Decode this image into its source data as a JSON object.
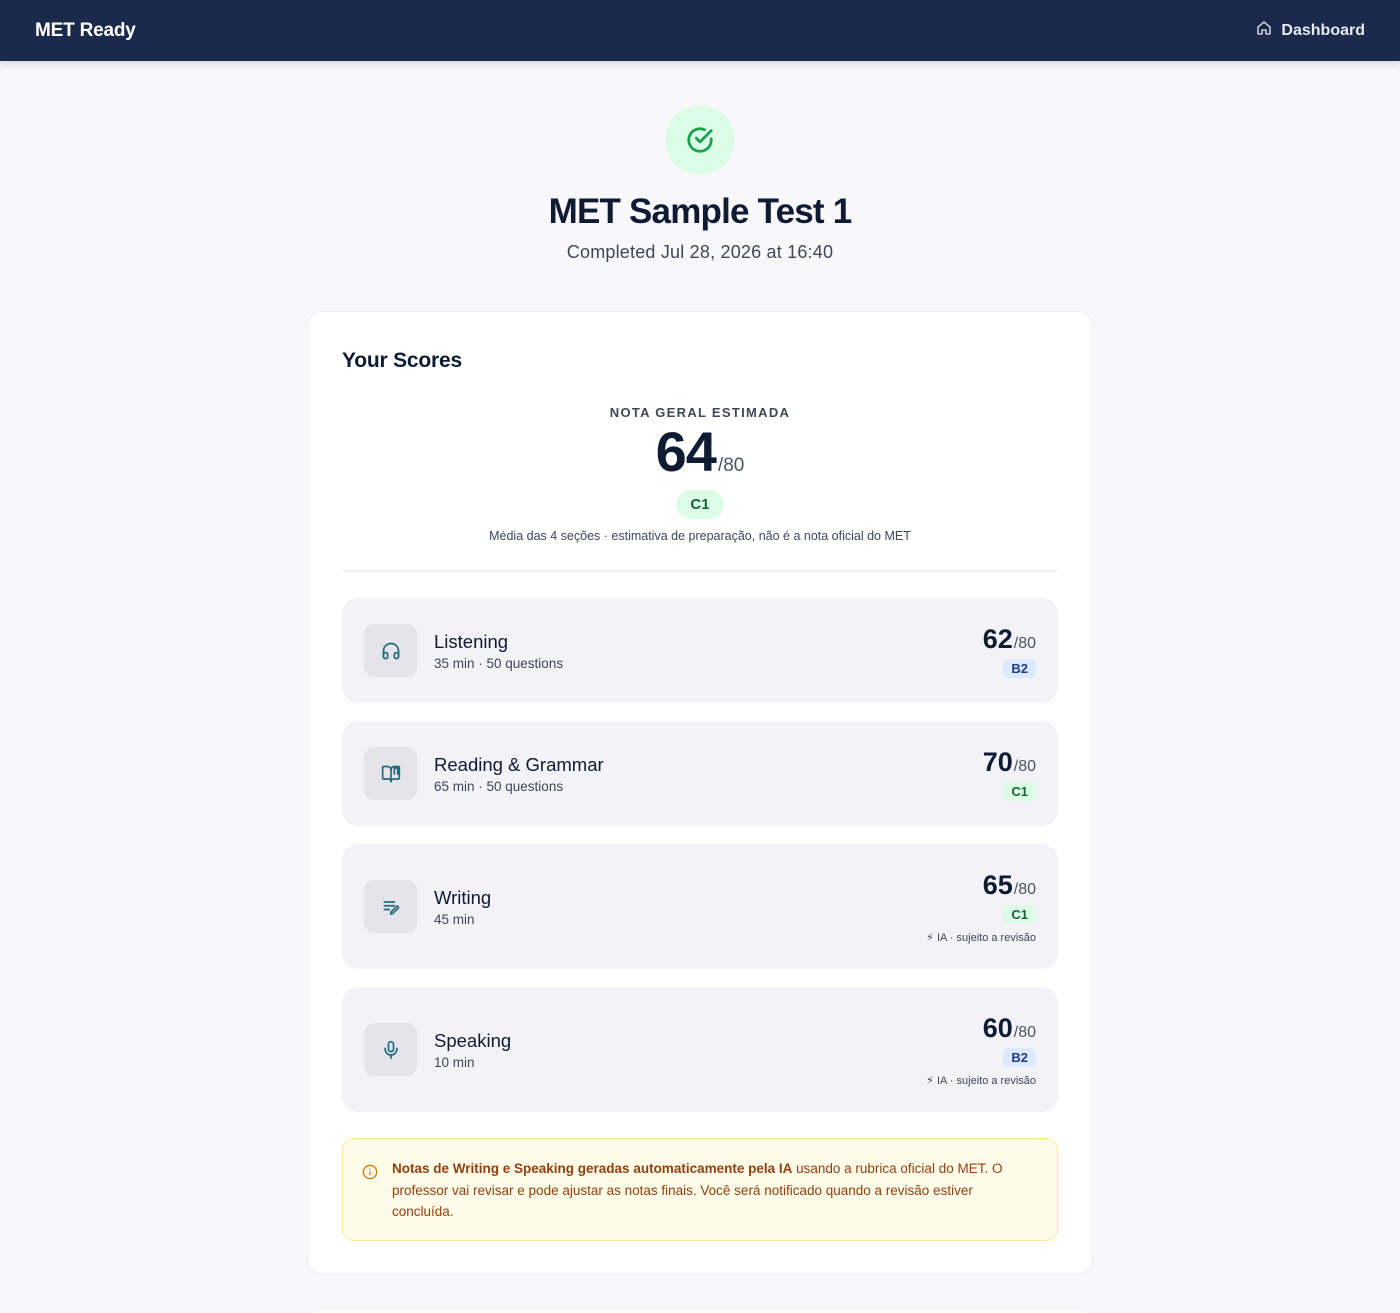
{
  "header": {
    "brand": "MET Ready",
    "nav_label": "Dashboard",
    "nav_icon": "home-icon"
  },
  "hero": {
    "icon": "check-circle-icon",
    "title": "MET Sample Test 1",
    "subtitle": "Completed Jul 28, 2026 at 16:40"
  },
  "scores": {
    "title": "Your Scores",
    "overall": {
      "label": "NOTA GERAL ESTIMADA",
      "score": "64",
      "max": "/80",
      "level": "C1",
      "note": "Média das 4 seções · estimativa de preparação, não é a nota oficial do MET"
    },
    "sections": [
      {
        "name": "Listening",
        "meta": "35 min · 50 questions",
        "score": "62",
        "max": "/80",
        "level": "B2",
        "icon": "headphones-icon",
        "ai_note": ""
      },
      {
        "name": "Reading & Grammar",
        "meta": "65 min · 50 questions",
        "score": "70",
        "max": "/80",
        "level": "C1",
        "icon": "book-open-icon",
        "ai_note": ""
      },
      {
        "name": "Writing",
        "meta": "45 min",
        "score": "65",
        "max": "/80",
        "level": "C1",
        "icon": "pen-lines-icon",
        "ai_note": "⚡ IA · sujeito a revisão"
      },
      {
        "name": "Speaking",
        "meta": "10 min",
        "score": "60",
        "max": "/80",
        "level": "B2",
        "icon": "microphone-icon",
        "ai_note": "⚡ IA · sujeito a revisão"
      }
    ],
    "notice": {
      "icon": "info-icon",
      "bold": "Notas de Writing e Speaking geradas automaticamente pela IA",
      "text": " usando a rubrica oficial do MET. O professor vai revisar e pode ajustar as notas finais. Você será notificado quando a revisão estiver concluída."
    }
  },
  "colors": {
    "header_bg": "#1b2a4a",
    "accent_teal": "#1f6b7a",
    "success_green": "#16a34a",
    "badge_b2_bg": "#dbeafe",
    "badge_c1_bg": "#dcfce7",
    "notice_bg": "#fefbe8",
    "notice_text": "#92400e"
  }
}
